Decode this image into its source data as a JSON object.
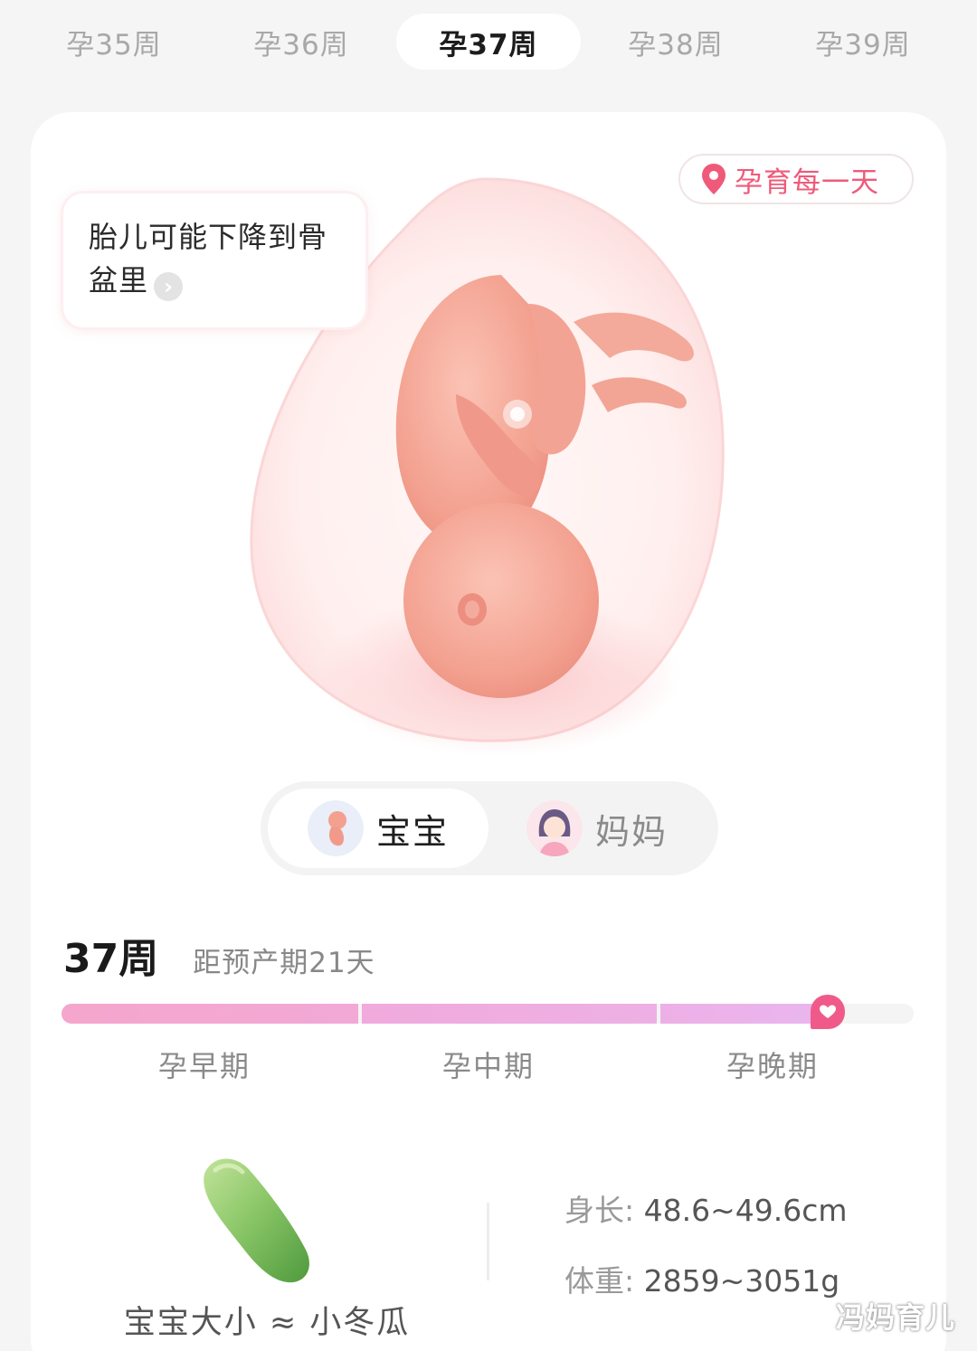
{
  "week_tabs": [
    "孕35周",
    "孕36周",
    "孕37周",
    "孕38周",
    "孕39周"
  ],
  "active_week_index": 2,
  "location_chip": {
    "icon": "location-pin-icon",
    "label": "孕育每一天"
  },
  "tip": {
    "text": "胎儿可能下降到骨盆里",
    "icon": "chevron-right-icon"
  },
  "toggle": {
    "baby_label": "宝宝",
    "mom_label": "妈妈",
    "selected": "宝宝"
  },
  "status": {
    "week": "37周",
    "due": "距预产期21天"
  },
  "progress": {
    "stages": [
      "孕早期",
      "孕中期",
      "孕晚期"
    ],
    "current_week": 37,
    "total_weeks": 40,
    "marker_icon": "heart-icon"
  },
  "size": {
    "caption": "宝宝大小 ≈ 小冬瓜",
    "length_label": "身长:",
    "length_value": "48.6~49.6cm",
    "weight_label": "体重:",
    "weight_value": "2859~3051g"
  },
  "watermark": "冯妈育儿",
  "colors": {
    "accent_pink": "#ef5a7a",
    "progress_pink": "#f5a6cc",
    "heart": "#f05a8a"
  }
}
